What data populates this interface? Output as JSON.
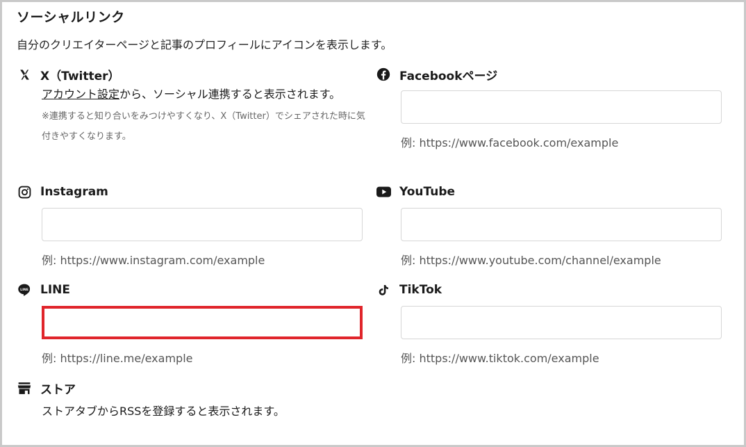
{
  "page": {
    "title": "ソーシャルリンク",
    "description": "自分のクリエイターページと記事のプロフィールにアイコンを表示します。"
  },
  "services": {
    "twitter": {
      "name": "X（Twitter）",
      "link_label": "アカウント設定",
      "note": "から、ソーシャル連携すると表示されます。",
      "small_note": "※連携すると知り合いをみつけやすくなり、X（Twitter）でシェアされた時に気付きやすくなります。"
    },
    "facebook": {
      "name": "Facebookページ",
      "value": "",
      "example": "例: https://www.facebook.com/example"
    },
    "instagram": {
      "name": "Instagram",
      "value": "",
      "example": "例: https://www.instagram.com/example"
    },
    "youtube": {
      "name": "YouTube",
      "value": "",
      "example": "例: https://www.youtube.com/channel/example"
    },
    "line": {
      "name": "LINE",
      "value": "",
      "example": "例: https://line.me/example"
    },
    "tiktok": {
      "name": "TikTok",
      "value": "",
      "example": "例: https://www.tiktok.com/example"
    },
    "store": {
      "name": "ストア",
      "note": "ストアタブからRSSを登録すると表示されます。"
    }
  },
  "icons": {
    "twitter": "x-logo-icon",
    "facebook": "facebook-icon",
    "instagram": "instagram-icon",
    "youtube": "youtube-icon",
    "line": "line-icon",
    "tiktok": "tiktok-icon",
    "store": "store-icon"
  },
  "colors": {
    "highlight": "#e0252b",
    "border": "#d6d6d6"
  }
}
